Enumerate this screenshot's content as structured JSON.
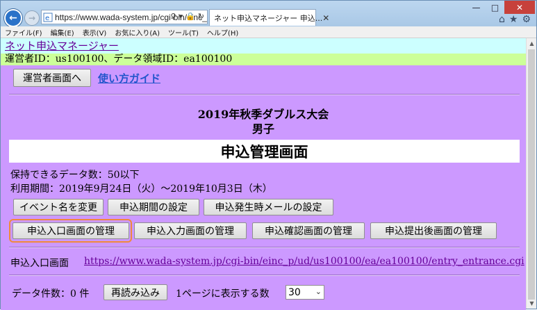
{
  "browser": {
    "url": "https://www.wada-system.jp/cgi-bin/einc_",
    "tab_title": "ネット申込マネージャー 申込...",
    "menu": [
      "ファイル(F)",
      "編集(E)",
      "表示(V)",
      "お気に入り(A)",
      "ツール(T)",
      "ヘルプ(H)"
    ]
  },
  "page": {
    "app_link": "ネット申込マネージャー",
    "operator_info": "運営者ID：us100100、データ領域ID：ea100100",
    "operator_button": "運営者画面へ",
    "guide_link": "使い方ガイド",
    "event_title": "2019年秋季ダブルス大会",
    "event_category": "男子",
    "screen_title": "申込管理画面",
    "data_limit": "保持できるデータ数：50以下",
    "usage_period": "利用期間：2019年9月24日（火）〜2019年10月3日（木）",
    "buttons_row1": [
      "イベント名を変更",
      "申込期間の設定",
      "申込発生時メールの設定"
    ],
    "buttons_row2": [
      "申込入口画面の管理",
      "申込入力画面の管理",
      "申込確認画面の管理",
      "申込提出後画面の管理"
    ],
    "entry_label": "申込入口画面",
    "entry_url": "https://www.wada-system.jp/cgi-bin/einc_p/ud/us100100/ea/ea100100/entry_entrance.cgi",
    "data_count": "データ件数：0 件",
    "reload_button": "再読み込み",
    "per_page_label": "1ページに表示する数",
    "per_page_value": "30"
  },
  "colors": {
    "content_bg": "#cc99ff",
    "header_link_bg": "#ccffff",
    "operator_bg": "#ccff99",
    "highlight": "#f08a3c"
  }
}
